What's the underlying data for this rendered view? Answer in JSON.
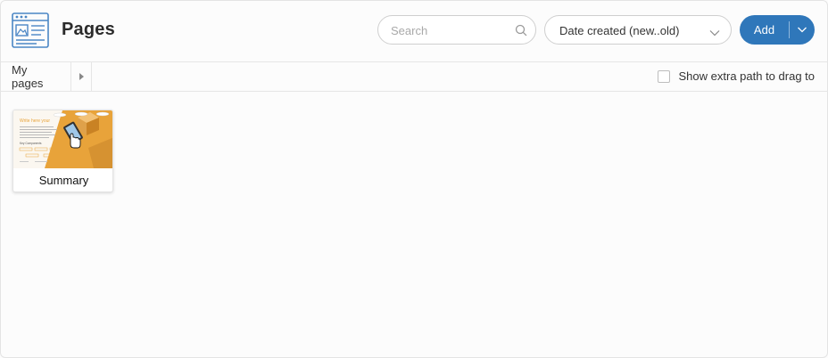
{
  "header": {
    "title": "Pages",
    "icon": "page-layout-icon",
    "search": {
      "placeholder": "Search",
      "value": "",
      "icon": "search-icon"
    },
    "sort": {
      "selected": "Date created (new..old)",
      "icon": "chevron-down-icon"
    },
    "add": {
      "label": "Add",
      "dropdown_icon": "chevron-down-icon"
    }
  },
  "toolbar": {
    "breadcrumb": [
      "My pages"
    ],
    "expand_icon": "caret-right-icon",
    "extra_path": {
      "label": "Show extra path to drag to",
      "checked": false
    }
  },
  "pages": [
    {
      "title": "Summary",
      "thumbnail": {
        "heading": "Write here your",
        "subheading": "Key Components",
        "icon": "hand-pointer-icon"
      }
    }
  ],
  "colors": {
    "accent": "#2f77ba",
    "thumbnail_orange": "#e8a33a",
    "icon_blue": "#4a86c5"
  }
}
